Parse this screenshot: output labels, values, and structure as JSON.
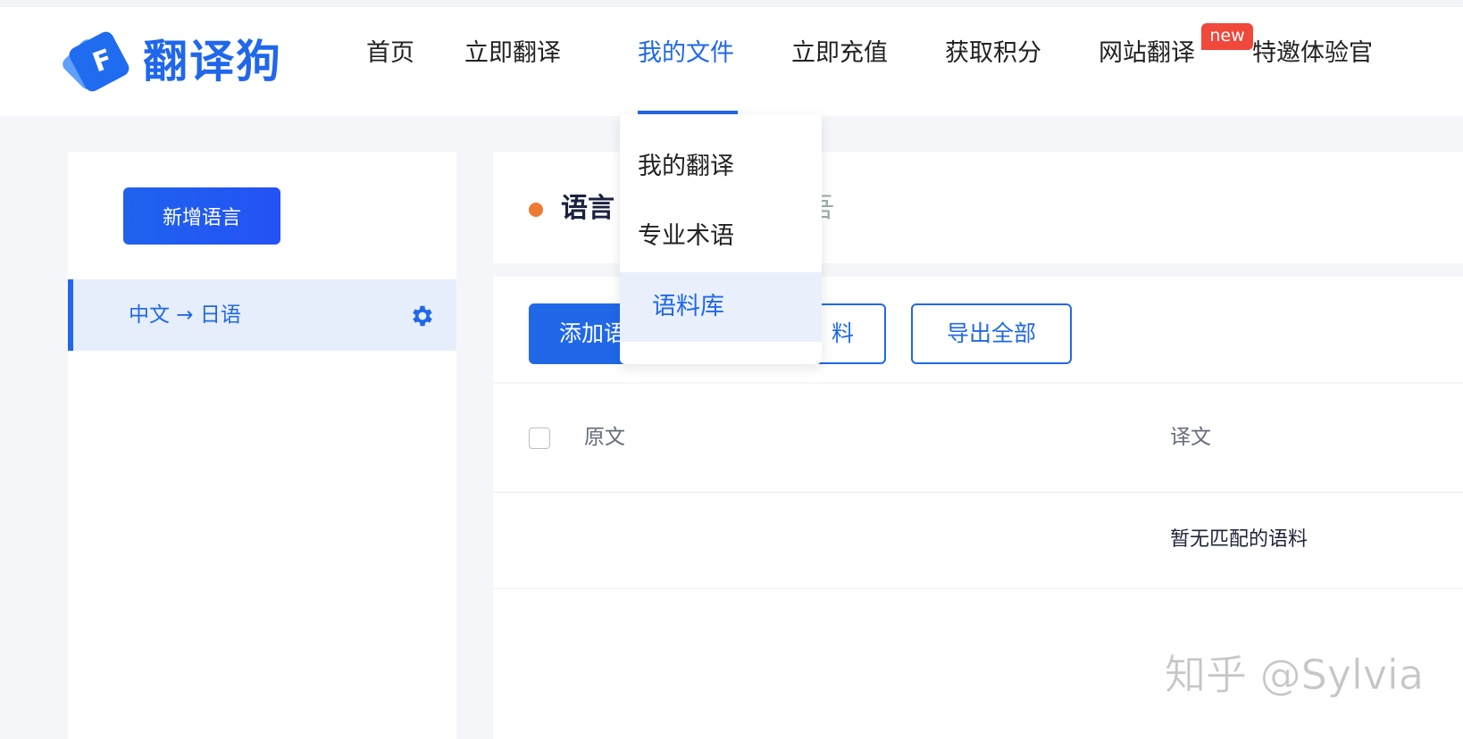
{
  "header": {
    "logo_text": "翻译狗",
    "nav": [
      {
        "label": "首页"
      },
      {
        "label": "立即翻译"
      },
      {
        "label": "我的文件"
      },
      {
        "label": "立即充值"
      },
      {
        "label": "获取积分"
      },
      {
        "label": "网站翻译"
      },
      {
        "label": "特邀体验官"
      }
    ],
    "new_badge": "new",
    "active_nav": "我的文件"
  },
  "dropdown": {
    "items": [
      {
        "label": "我的翻译"
      },
      {
        "label": "专业术语"
      },
      {
        "label": "语料库"
      }
    ],
    "selected": "语料库"
  },
  "sidebar": {
    "add_button": "新增语言",
    "language_pair": "中文 → 日语"
  },
  "main": {
    "title": "语言",
    "title_tail": "吾",
    "add_button": "添加语",
    "import_button_tail": "料",
    "export_button": "导出全部",
    "table": {
      "col_source": "原文",
      "col_target": "译文",
      "empty": "暂无匹配的语料"
    }
  },
  "watermark": "知乎 @Sylvia",
  "colors": {
    "accent": "#2068e8",
    "badge": "#f0483b",
    "dot": "#ee7a34"
  }
}
